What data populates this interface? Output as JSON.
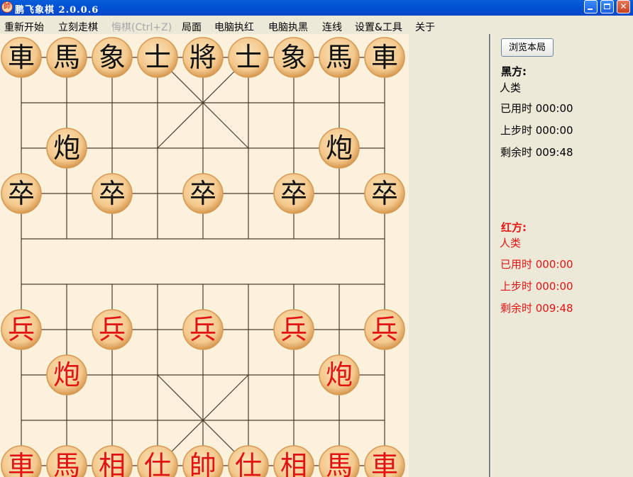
{
  "window": {
    "title": "鹏飞象棋 2.0.0.6",
    "icon_glyph": "帥",
    "buttons": {
      "minimize": "minimize-icon",
      "maximize": "maximize-icon",
      "close": "✕"
    }
  },
  "menu": [
    {
      "label": "重新开始",
      "enabled": true
    },
    {
      "label": "立刻走棋",
      "enabled": true
    },
    {
      "label": "悔棋(Ctrl+Z)",
      "enabled": false
    },
    {
      "label": "局面",
      "enabled": true
    },
    {
      "label": "电脑执红",
      "enabled": true
    },
    {
      "label": "电脑执黑",
      "enabled": true
    },
    {
      "label": "连线",
      "enabled": true
    },
    {
      "label": "设置&工具",
      "enabled": true
    },
    {
      "label": "关于",
      "enabled": true
    }
  ],
  "board": {
    "files": 9,
    "ranks": 10,
    "colors": {
      "background": "#fcf1dc",
      "line": "#4a3a2a",
      "piece_face": "#f4c98e",
      "piece_edge": "#d79a52",
      "black_text": "#111111",
      "red_text": "#e31313"
    },
    "pieces": [
      {
        "glyph": "車",
        "side": "black",
        "file": 0,
        "rank": 0
      },
      {
        "glyph": "馬",
        "side": "black",
        "file": 1,
        "rank": 0
      },
      {
        "glyph": "象",
        "side": "black",
        "file": 2,
        "rank": 0
      },
      {
        "glyph": "士",
        "side": "black",
        "file": 3,
        "rank": 0
      },
      {
        "glyph": "將",
        "side": "black",
        "file": 4,
        "rank": 0
      },
      {
        "glyph": "士",
        "side": "black",
        "file": 5,
        "rank": 0
      },
      {
        "glyph": "象",
        "side": "black",
        "file": 6,
        "rank": 0
      },
      {
        "glyph": "馬",
        "side": "black",
        "file": 7,
        "rank": 0
      },
      {
        "glyph": "車",
        "side": "black",
        "file": 8,
        "rank": 0
      },
      {
        "glyph": "炮",
        "side": "black",
        "file": 1,
        "rank": 2
      },
      {
        "glyph": "炮",
        "side": "black",
        "file": 7,
        "rank": 2
      },
      {
        "glyph": "卒",
        "side": "black",
        "file": 0,
        "rank": 3
      },
      {
        "glyph": "卒",
        "side": "black",
        "file": 2,
        "rank": 3
      },
      {
        "glyph": "卒",
        "side": "black",
        "file": 4,
        "rank": 3
      },
      {
        "glyph": "卒",
        "side": "black",
        "file": 6,
        "rank": 3
      },
      {
        "glyph": "卒",
        "side": "black",
        "file": 8,
        "rank": 3
      },
      {
        "glyph": "兵",
        "side": "red",
        "file": 0,
        "rank": 6
      },
      {
        "glyph": "兵",
        "side": "red",
        "file": 2,
        "rank": 6
      },
      {
        "glyph": "兵",
        "side": "red",
        "file": 4,
        "rank": 6
      },
      {
        "glyph": "兵",
        "side": "red",
        "file": 6,
        "rank": 6
      },
      {
        "glyph": "兵",
        "side": "red",
        "file": 8,
        "rank": 6
      },
      {
        "glyph": "炮",
        "side": "red",
        "file": 1,
        "rank": 7
      },
      {
        "glyph": "炮",
        "side": "red",
        "file": 7,
        "rank": 7
      },
      {
        "glyph": "車",
        "side": "red",
        "file": 0,
        "rank": 9
      },
      {
        "glyph": "馬",
        "side": "red",
        "file": 1,
        "rank": 9
      },
      {
        "glyph": "相",
        "side": "red",
        "file": 2,
        "rank": 9
      },
      {
        "glyph": "仕",
        "side": "red",
        "file": 3,
        "rank": 9
      },
      {
        "glyph": "帥",
        "side": "red",
        "file": 4,
        "rank": 9
      },
      {
        "glyph": "仕",
        "side": "red",
        "file": 5,
        "rank": 9
      },
      {
        "glyph": "相",
        "side": "red",
        "file": 6,
        "rank": 9
      },
      {
        "glyph": "馬",
        "side": "red",
        "file": 7,
        "rank": 9
      },
      {
        "glyph": "車",
        "side": "red",
        "file": 8,
        "rank": 9
      }
    ]
  },
  "panel": {
    "browse_button": "浏览本局",
    "black": {
      "heading": "黑方:",
      "player": "人类",
      "used_time": "已用时 000:00",
      "last_move": "上步时 000:00",
      "remaining": "剩余时 009:48",
      "color": "#000000"
    },
    "red": {
      "heading": "红方:",
      "player": "人类",
      "used_time": "已用时 000:00",
      "last_move": "上步时 000:00",
      "remaining": "剩余时 009:48",
      "color": "#e31313"
    }
  }
}
